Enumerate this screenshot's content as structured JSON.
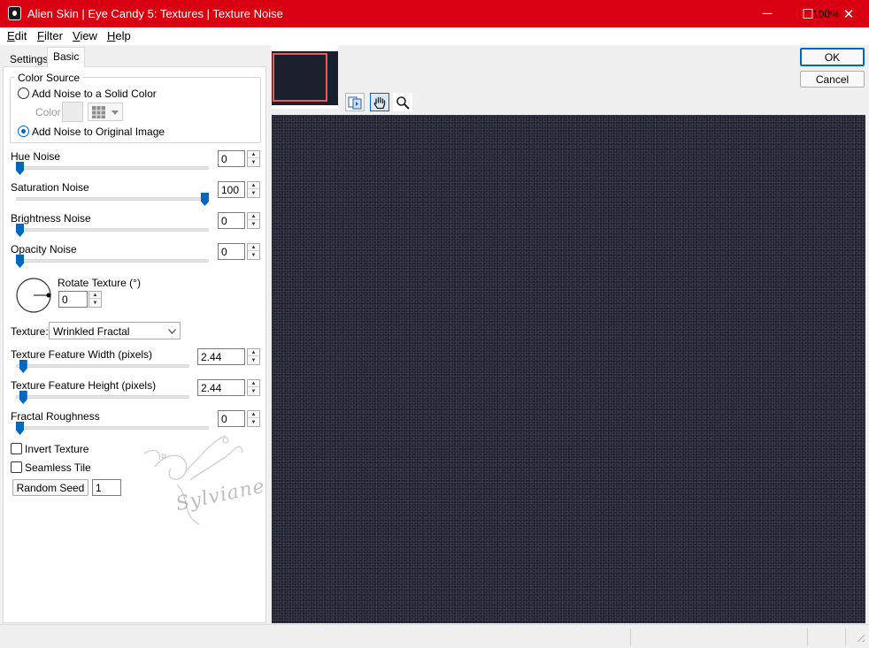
{
  "window": {
    "title": "Alien Skin | Eye Candy 5: Textures | Texture Noise",
    "controls": {
      "minimize": "─",
      "maximize": "☐",
      "close": "✕"
    }
  },
  "menu": [
    {
      "label_ul": "E",
      "label_rest": "dit"
    },
    {
      "label_ul": "F",
      "label_rest": "ilter"
    },
    {
      "label_ul": "V",
      "label_rest": "iew"
    },
    {
      "label_ul": "H",
      "label_rest": "elp"
    }
  ],
  "tabs": {
    "settings": "Settings",
    "basic": "Basic",
    "active": "Basic"
  },
  "color_source": {
    "title": "Color Source",
    "option_solid": "Add Noise to a Solid Color",
    "color_label": "Color",
    "option_original": "Add Noise to Original Image",
    "selected": "Add Noise to Original Image",
    "swatch_color": "#ececec"
  },
  "sliders": {
    "hue": {
      "label": "Hue Noise",
      "value": "0",
      "fraction": 0.0
    },
    "saturation": {
      "label": "Saturation Noise",
      "value": "100",
      "fraction": 1.0
    },
    "brightness": {
      "label": "Brightness Noise",
      "value": "0",
      "fraction": 0.0
    },
    "opacity": {
      "label": "Opacity Noise",
      "value": "0",
      "fraction": 0.0
    },
    "feature_width": {
      "label": "Texture Feature Width (pixels)",
      "value": "2.44",
      "fraction": 0.02
    },
    "feature_height": {
      "label": "Texture Feature Height (pixels)",
      "value": "2.44",
      "fraction": 0.02
    },
    "roughness": {
      "label": "Fractal Roughness",
      "value": "0",
      "fraction": 0.0
    }
  },
  "rotate": {
    "label": "Rotate Texture (°)",
    "value": "0"
  },
  "texture": {
    "label": "Texture:",
    "selected": "Wrinkled Fractal"
  },
  "checkboxes": {
    "invert": {
      "label": "Invert Texture",
      "checked": false
    },
    "seamless": {
      "label": "Seamless Tile",
      "checked": false
    }
  },
  "random_seed": {
    "button": "Random Seed",
    "value": "1"
  },
  "buttons": {
    "ok": "OK",
    "cancel": "Cancel"
  },
  "watermark": "Sylviane",
  "status": {
    "zoom": "100%"
  },
  "colors": {
    "titlebar": "#d90012",
    "accent": "#0067c0",
    "preview_bg": "#1d2030",
    "thumb_frame": "#e95a56"
  }
}
